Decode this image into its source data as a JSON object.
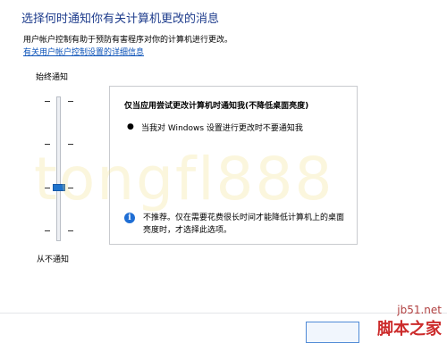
{
  "header": {
    "title": "选择何时通知你有关计算机更改的消息",
    "description": "用户帐户控制有助于预防有害程序对你的计算机进行更改。",
    "link": "有关用户帐户控制设置的详细信息"
  },
  "slider": {
    "top_label": "始终通知",
    "bottom_label": "从不通知",
    "level": 3,
    "levels_count": 4
  },
  "info": {
    "heading": "仅当应用尝试更改计算机时通知我(不降低桌面亮度)",
    "bullet_symbol": "●",
    "bullet": "当我对 Windows 设置进行更改时不要通知我",
    "info_icon": "i",
    "note": "不推荐。仅在需要花费很长时间才能降低计算机上的桌面亮度时，才选择此选项。"
  },
  "watermark": "tongfl888",
  "site_logo": {
    "domain": "jb51.net",
    "name": "脚本之家"
  },
  "colors": {
    "title": "#1e3c8c",
    "link": "#0b52b8",
    "thumb": "#1f73cc",
    "info_icon": "#1f6ed4"
  }
}
